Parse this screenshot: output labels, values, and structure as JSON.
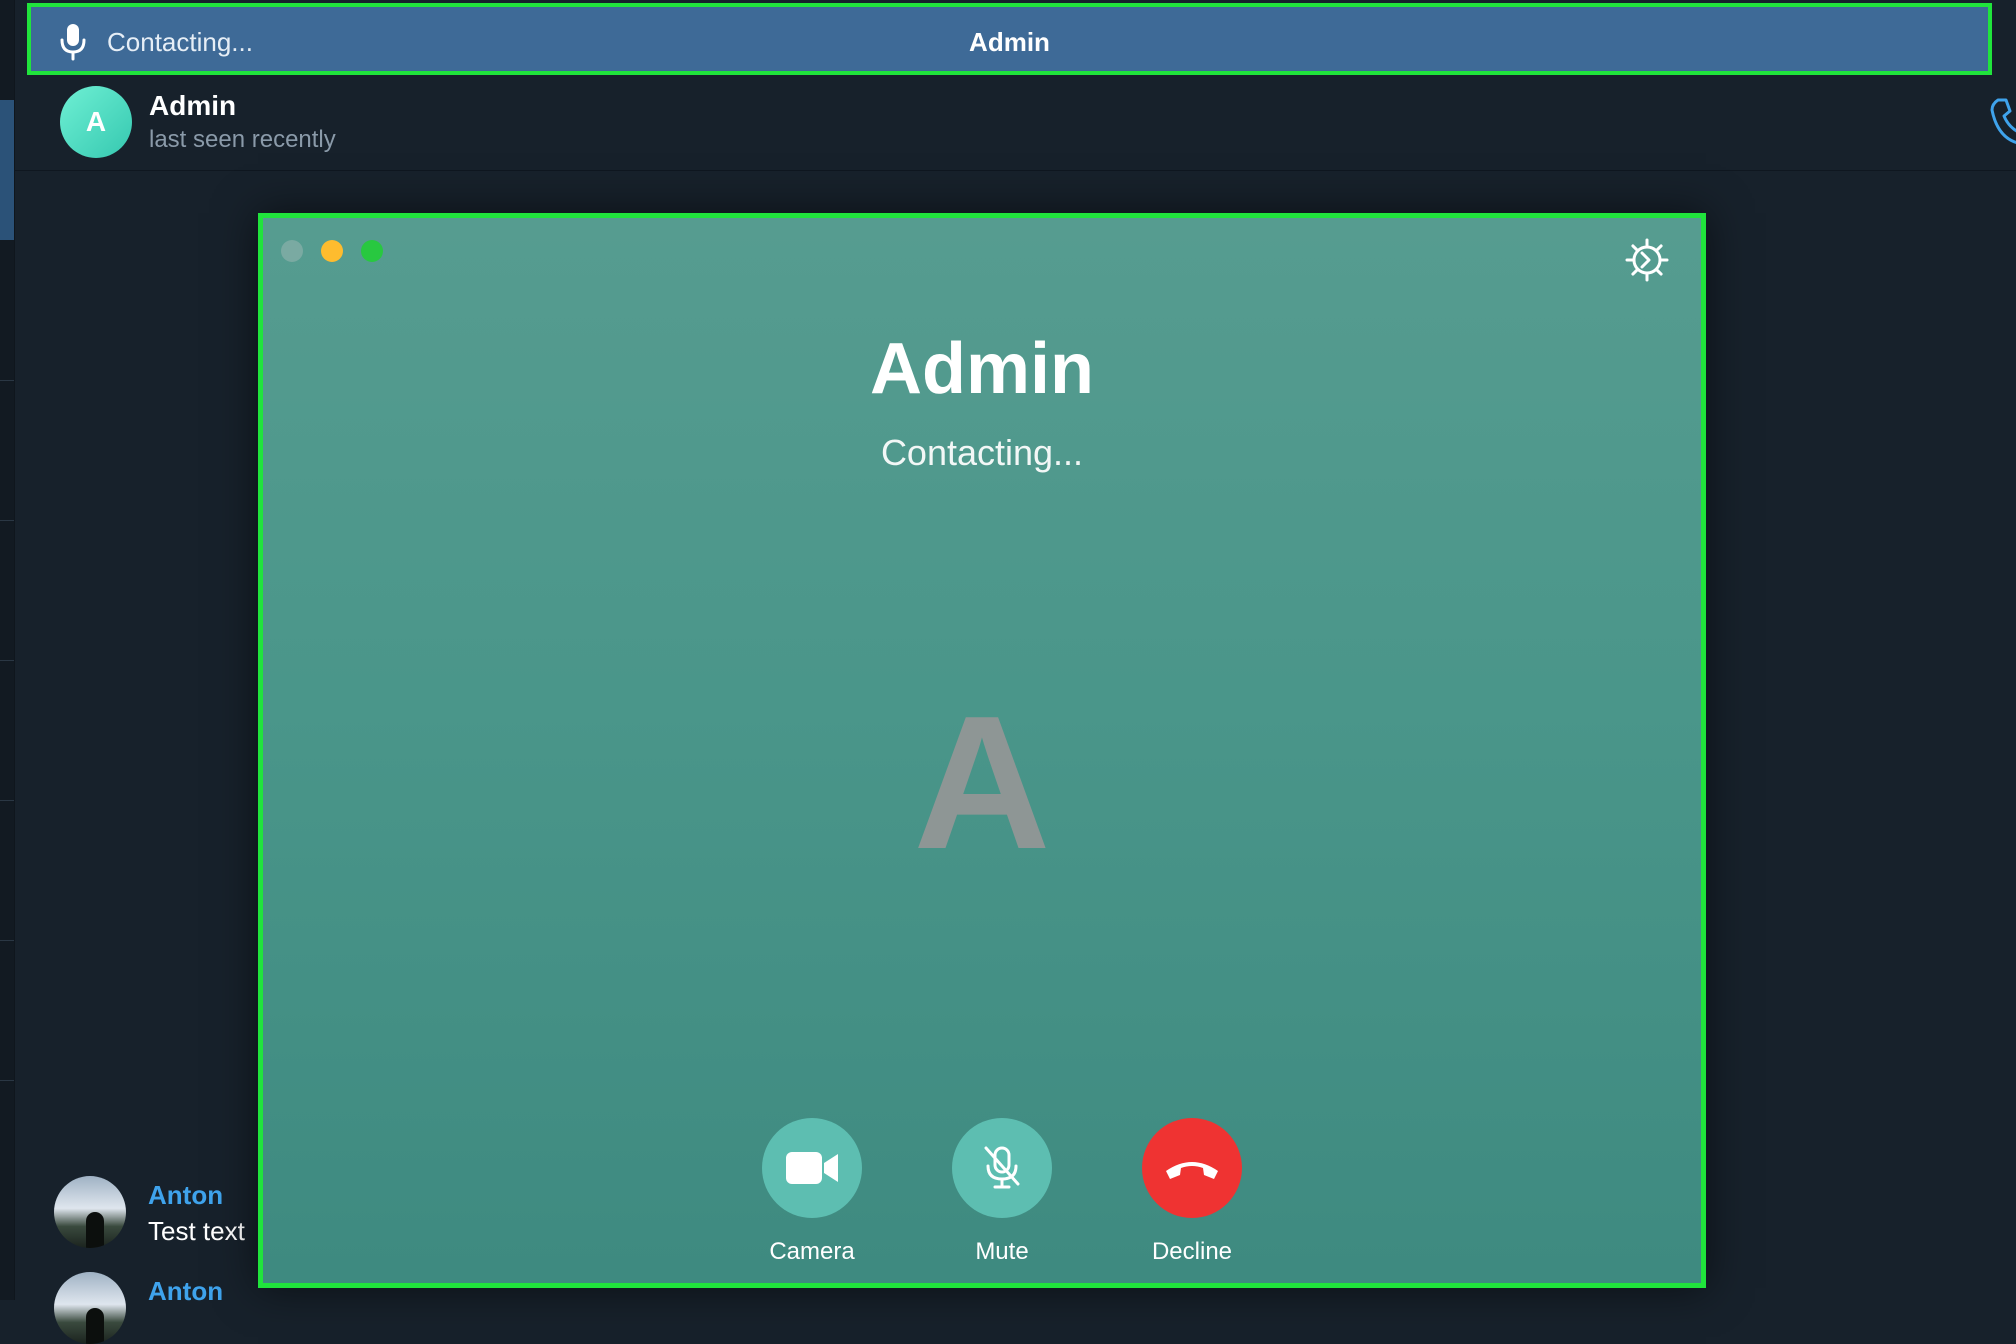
{
  "call_bar": {
    "status": "Contacting...",
    "name": "Admin"
  },
  "chat_header": {
    "avatar_letter": "A",
    "title": "Admin",
    "subtitle": "last seen recently"
  },
  "messages": [
    {
      "author": "Anton",
      "text": "Test text"
    },
    {
      "author": "Anton",
      "text": ""
    }
  ],
  "call_window": {
    "name": "Admin",
    "status": "Contacting...",
    "avatar_letter": "A",
    "controls": [
      {
        "label": "Camera",
        "icon": "camera-icon"
      },
      {
        "label": "Mute",
        "icon": "mic-off-icon"
      },
      {
        "label": "Decline",
        "icon": "phone-hangup-icon"
      }
    ]
  },
  "colors": {
    "app_background": "#17212b",
    "call_bar": "#3e6a97",
    "call_window": "#4a968a",
    "highlight_border": "#20e43c",
    "decline": "#ef3332",
    "link_name": "#3fa3ec"
  }
}
